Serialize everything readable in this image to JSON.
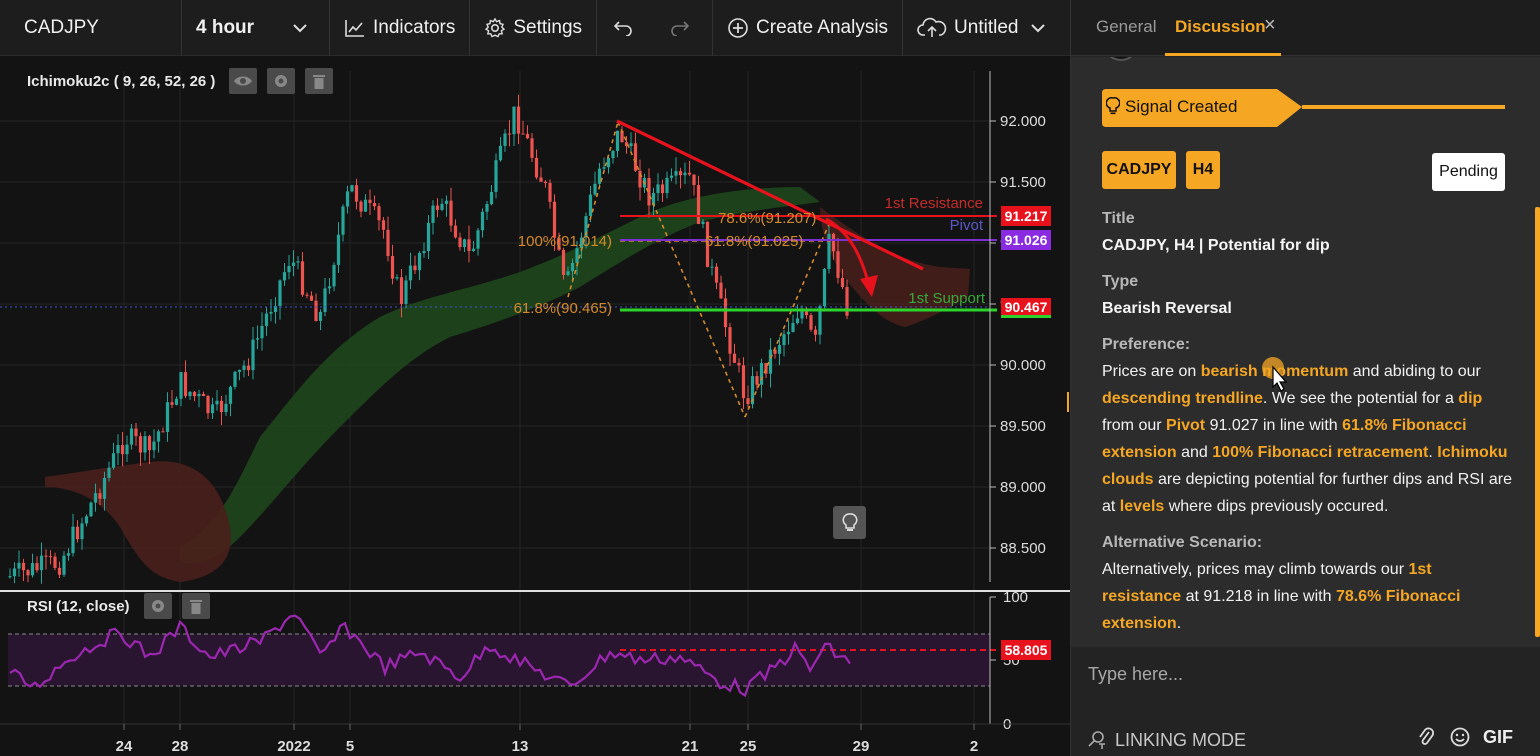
{
  "toolbar": {
    "symbol": "CADJPY",
    "interval": "4 hour",
    "indicators_label": "Indicators",
    "settings_label": "Settings",
    "create_analysis_label": "Create Analysis",
    "layout_name": "Untitled"
  },
  "chart": {
    "main_study": "Ichimoku2c ( 9, 26, 52, 26 )",
    "rsi_study": "RSI (12, close)",
    "price_axis": [
      "92.000",
      "91.500",
      "91.000",
      "90.500",
      "90.000",
      "89.500",
      "89.000",
      "88.500"
    ],
    "rsi_axis": [
      "100",
      "50",
      "0"
    ],
    "time_axis": [
      "24",
      "28",
      "2022",
      "5",
      "13",
      "21",
      "25",
      "29",
      "2"
    ],
    "price_tags": {
      "resistance": "91.217",
      "pivot": "91.026",
      "support": "90.467",
      "rsi": "58.805"
    },
    "annotations": {
      "resistance": "1st Resistance",
      "pivot": "Pivot",
      "support": "1st Support",
      "fib_786": "78.6%(91.207)",
      "fib_618_ext": "61.8%(91.025)",
      "fib_100": "100%(91.014)",
      "fib_618": "61.8%(90.465)"
    },
    "colors": {
      "bull": "#26a69a",
      "bear": "#ef5350",
      "resistance": "#e8121d",
      "pivot": "#7d2fd6",
      "support": "#2bd32b",
      "rsi": "#9c27b0",
      "fib": "#d48a2a"
    }
  },
  "panel": {
    "tabs": [
      "General",
      "Discussion"
    ],
    "signal_label": "Signal Created",
    "symbol_tag": "CADJPY",
    "timeframe_tag": "H4",
    "status": "Pending",
    "title_label": "Title",
    "title_value": "CADJPY, H4 | Potential for dip",
    "type_label": "Type",
    "type_value": "Bearish Reversal",
    "preference_label": "Preference:",
    "preference_text": [
      "Prices are on ",
      "bearish momentum",
      " and abiding to our ",
      "descending trendline",
      ". We see the potential for a ",
      "dip",
      " from our ",
      "Pivot",
      " 91.027 in line with ",
      "61.8% Fibonacci extension",
      " and ",
      "100% Fibonacci retracement",
      ". ",
      "Ichimoku clouds",
      " are depicting potential for further dips and RSI are at ",
      "levels",
      " where dips previously occured."
    ],
    "alternative_label": "Alternative Scenario:",
    "alternative_text": [
      "Alternatively, prices may climb towards our ",
      "1st resistance",
      " at 91.218 in line with ",
      "78.6% Fibonacci extension",
      "."
    ],
    "reply_placeholder": "Type here...",
    "linking_mode": "LINKING MODE",
    "gif_label": "GIF"
  }
}
